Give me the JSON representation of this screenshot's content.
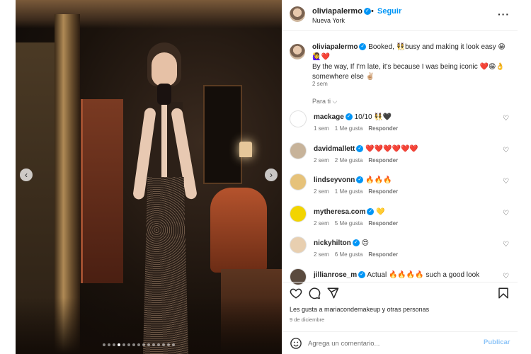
{
  "post": {
    "username": "oliviapalermo",
    "follow_label": "Seguir",
    "location": "Nueva York",
    "more_label": "···"
  },
  "caption": {
    "username": "oliviapalermo",
    "line1": "Booked, 👯‍♀️busy and making it look easy 😁🙋‍♀️❤️",
    "line2": "By the way, If I'm late, it's because I was being iconic ❤️😁👌",
    "line3": "somewhere else ✌🏼",
    "time": "2 sem"
  },
  "sort_label": "Para ti",
  "comments": [
    {
      "user": "mackage",
      "text": "10/10 👯‍♀️🖤",
      "time": "1 sem",
      "likes": "1 Me gusta",
      "reply": "Responder",
      "avatar_bg": "#ffffff"
    },
    {
      "user": "davidmallett",
      "text": "❤️❤️❤️❤️❤️❤️",
      "time": "2 sem",
      "likes": "2 Me gusta",
      "reply": "Responder",
      "avatar_bg": "#c7b39a"
    },
    {
      "user": "lindseyvonn",
      "text": "🔥🔥🔥",
      "time": "2 sem",
      "likes": "1 Me gusta",
      "reply": "Responder",
      "avatar_bg": "#e6c27a"
    },
    {
      "user": "mytheresa.com",
      "text": "💛",
      "time": "2 sem",
      "likes": "5 Me gusta",
      "reply": "Responder",
      "avatar_bg": "#f2d400"
    },
    {
      "user": "nickyhilton",
      "text": "😍",
      "time": "2 sem",
      "likes": "6 Me gusta",
      "reply": "Responder",
      "avatar_bg": "#e8cfb0"
    },
    {
      "user": "jillianrose_m",
      "text": "Actual 🔥🔥🔥🔥 such a good look",
      "time": "",
      "likes": "",
      "reply": "",
      "avatar_bg": "#5a4a3e"
    }
  ],
  "likes_text": "Les gusta a mariacondemakeup y otras personas",
  "date": "9 de diciembre",
  "comment_box": {
    "placeholder": "Agrega un comentario...",
    "publish_label": "Publicar"
  },
  "colors": {
    "accent": "#0095f6",
    "publish_disabled": "#8ec5f8",
    "muted": "#737373"
  },
  "icons": [
    "heart-icon",
    "comment-icon",
    "share-icon",
    "bookmark-icon",
    "emoji-icon",
    "more-icon",
    "verified-icon"
  ],
  "carousel": {
    "total": 15,
    "active": 3
  }
}
